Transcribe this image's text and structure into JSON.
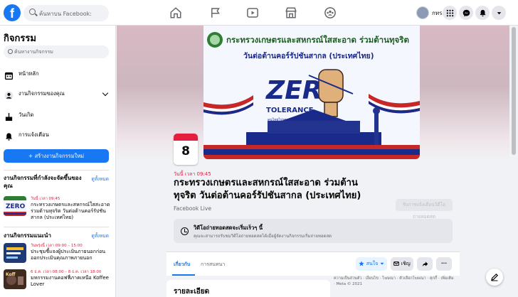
{
  "header": {
    "logo": "f",
    "search_placeholder": "ค้นหาบน Facebook:",
    "profile_name": "กทร.",
    "nav_icons": [
      "home-icon",
      "pages-icon",
      "watch-icon",
      "marketplace-icon",
      "groups-icon"
    ]
  },
  "sidebar": {
    "title": "กิจกรรม",
    "search_placeholder": "ค้นหางานกิจกรรม",
    "items": [
      {
        "label": "หน้าหลัก"
      },
      {
        "label": "งานกิจกรรมของคุณ"
      },
      {
        "label": "วันเกิด"
      },
      {
        "label": "การแจ้งเตือน"
      }
    ],
    "create_label": "+ สร้างงานกิจกรรมใหม่",
    "going_heading": "งานกิจกรรมที่กำลังจะจัดขึ้นของคุณ",
    "see_all": "ดูทั้งหมด",
    "going_events": [
      {
        "time": "วันนี้ เวลา 09:45",
        "name": "กระทรวงเกษตรและสหกรณ์ใสสะอาด ร่วมต้านทุจริต วันต่อต้านคอร์รัปชันสากล (ประเทศไทย)"
      }
    ],
    "suggested_heading": "งานกิจกรรมแนะนำ",
    "suggested_see_all": "ดูทั้งหมด",
    "suggested_events": [
      {
        "time": "วันพรุ่งนี้ เวลา 09:00 – 15:00",
        "name": "ประชุมชี้แจงผู้ประเมินภายนอกก่อนออกประเมินคุณภาพภายนอก"
      },
      {
        "time": "6 ธ.ค. เวลา 08:00 – 8 ธ.ค. เวลา 18:00",
        "name": "มหกรรมงานคอฟฟี่ภาคเหนือ Koffee Lover"
      }
    ]
  },
  "event": {
    "poster_line1": "กระทรวงเกษตรและสหกรณ์ใสสะอาด ร่วมต้านทุจริต",
    "poster_line2": "วันต่อต้านคอร์รัปชันสากล (ประเทศไทย)",
    "poster_zero": "ZERO",
    "poster_tolerance": "TOLERANCE",
    "poster_tagline": "คนไทยไม่ทนต่อการทุจริต",
    "day": "8",
    "when": "วันนี้ เวลา 09:45",
    "title": "กระทรวงเกษตรและสหกรณ์ใสสะอาด ร่วมต้านทุจริต วันต่อต้านคอร์รัปชันสากล (ประเทศไทย)",
    "host": "Facebook Live",
    "reminder_button": "รับการแจ้งเตือนวิดีโอถ่ายทอดสด",
    "notice_title": "วิดีโอถ่ายทอดสดจะเริ่มเร็วๆ นี้",
    "notice_sub": "คุณจะสามารถรับชมวิดีโอถ่ายทอดสดได้เมื่อผู้จัดงานกิจกรรมเริ่มถ่ายทอดสด",
    "tabs": [
      "เกี่ยวกับ",
      "การสนทนา"
    ],
    "interested_label": "สนใจ",
    "invite_label": "เชิญ",
    "more_label": "···",
    "details_heading": "รายละเอียด",
    "footer_text": "ความเป็นส่วนตัว · เงื่อนไข · โฆษณา · ตัวเลือกโฆษณา · คุกกี้ · เพิ่มเติม · Meta © 2021"
  },
  "colors": {
    "brand": "#1877f2",
    "alert": "#e41e3f",
    "poster_green": "#2e7d32",
    "poster_navy": "#1a2a8a"
  }
}
